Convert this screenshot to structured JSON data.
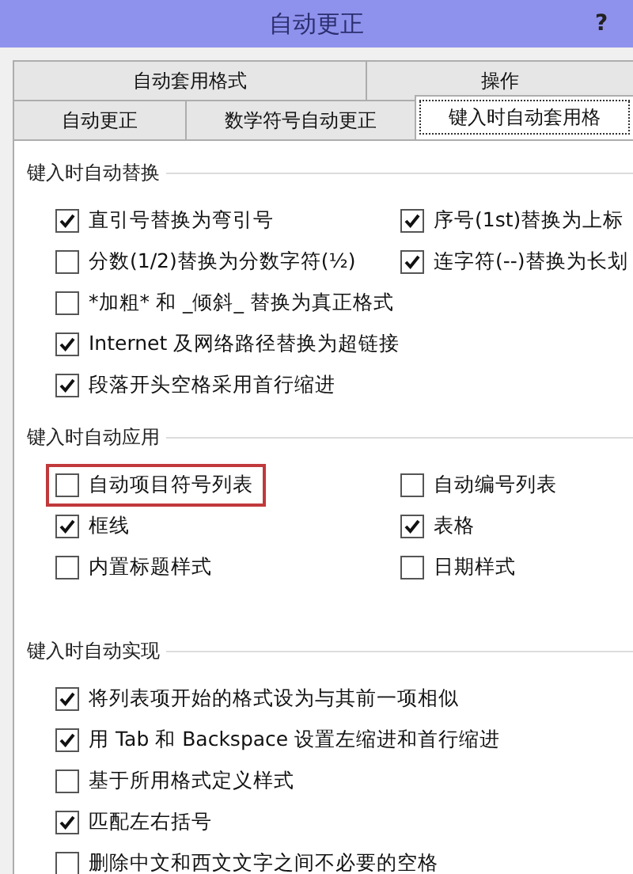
{
  "window": {
    "title": "自动更正",
    "help": "?"
  },
  "tab_rows": [
    [
      {
        "label": "自动套用格式",
        "selected": false
      },
      {
        "label": "操作",
        "selected": false
      }
    ],
    [
      {
        "label": "自动更正",
        "selected": false
      },
      {
        "label": "数学符号自动更正",
        "selected": false
      },
      {
        "label": "键入时自动套用格",
        "selected": true
      }
    ]
  ],
  "sections": [
    {
      "title": "键入时自动替换",
      "left": [
        {
          "label": "直引号替换为弯引号",
          "checked": true,
          "highlighted": false
        },
        {
          "label": "分数(1/2)替换为分数字符(½)",
          "checked": false,
          "highlighted": false
        },
        {
          "label": "*加粗* 和 _倾斜_ 替换为真正格式",
          "checked": false,
          "highlighted": false
        },
        {
          "label": "Internet 及网络路径替换为超链接",
          "checked": true,
          "highlighted": false
        },
        {
          "label": "段落开头空格采用首行缩进",
          "checked": true,
          "highlighted": false
        }
      ],
      "right": [
        {
          "label": "序号(1st)替换为上标",
          "checked": true,
          "highlighted": false
        },
        {
          "label": "连字符(--)替换为长划",
          "checked": true,
          "highlighted": false
        }
      ]
    },
    {
      "title": "键入时自动应用",
      "left": [
        {
          "label": "自动项目符号列表",
          "checked": false,
          "highlighted": true
        },
        {
          "label": "框线",
          "checked": true,
          "highlighted": false
        },
        {
          "label": "内置标题样式",
          "checked": false,
          "highlighted": false
        }
      ],
      "right": [
        {
          "label": "自动编号列表",
          "checked": false,
          "highlighted": false
        },
        {
          "label": "表格",
          "checked": true,
          "highlighted": false
        },
        {
          "label": "日期样式",
          "checked": false,
          "highlighted": false
        }
      ]
    },
    {
      "title": "键入时自动实现",
      "left": [
        {
          "label": "将列表项开始的格式设为与其前一项相似",
          "checked": true,
          "highlighted": false
        },
        {
          "label": "用 Tab 和 Backspace 设置左缩进和首行缩进",
          "checked": true,
          "highlighted": false
        },
        {
          "label": "基于所用格式定义样式",
          "checked": false,
          "highlighted": false
        },
        {
          "label": "匹配左右括号",
          "checked": true,
          "highlighted": false
        },
        {
          "label": "删除中文和西文文字之间不必要的空格",
          "checked": false,
          "highlighted": false
        }
      ]
    }
  ]
}
